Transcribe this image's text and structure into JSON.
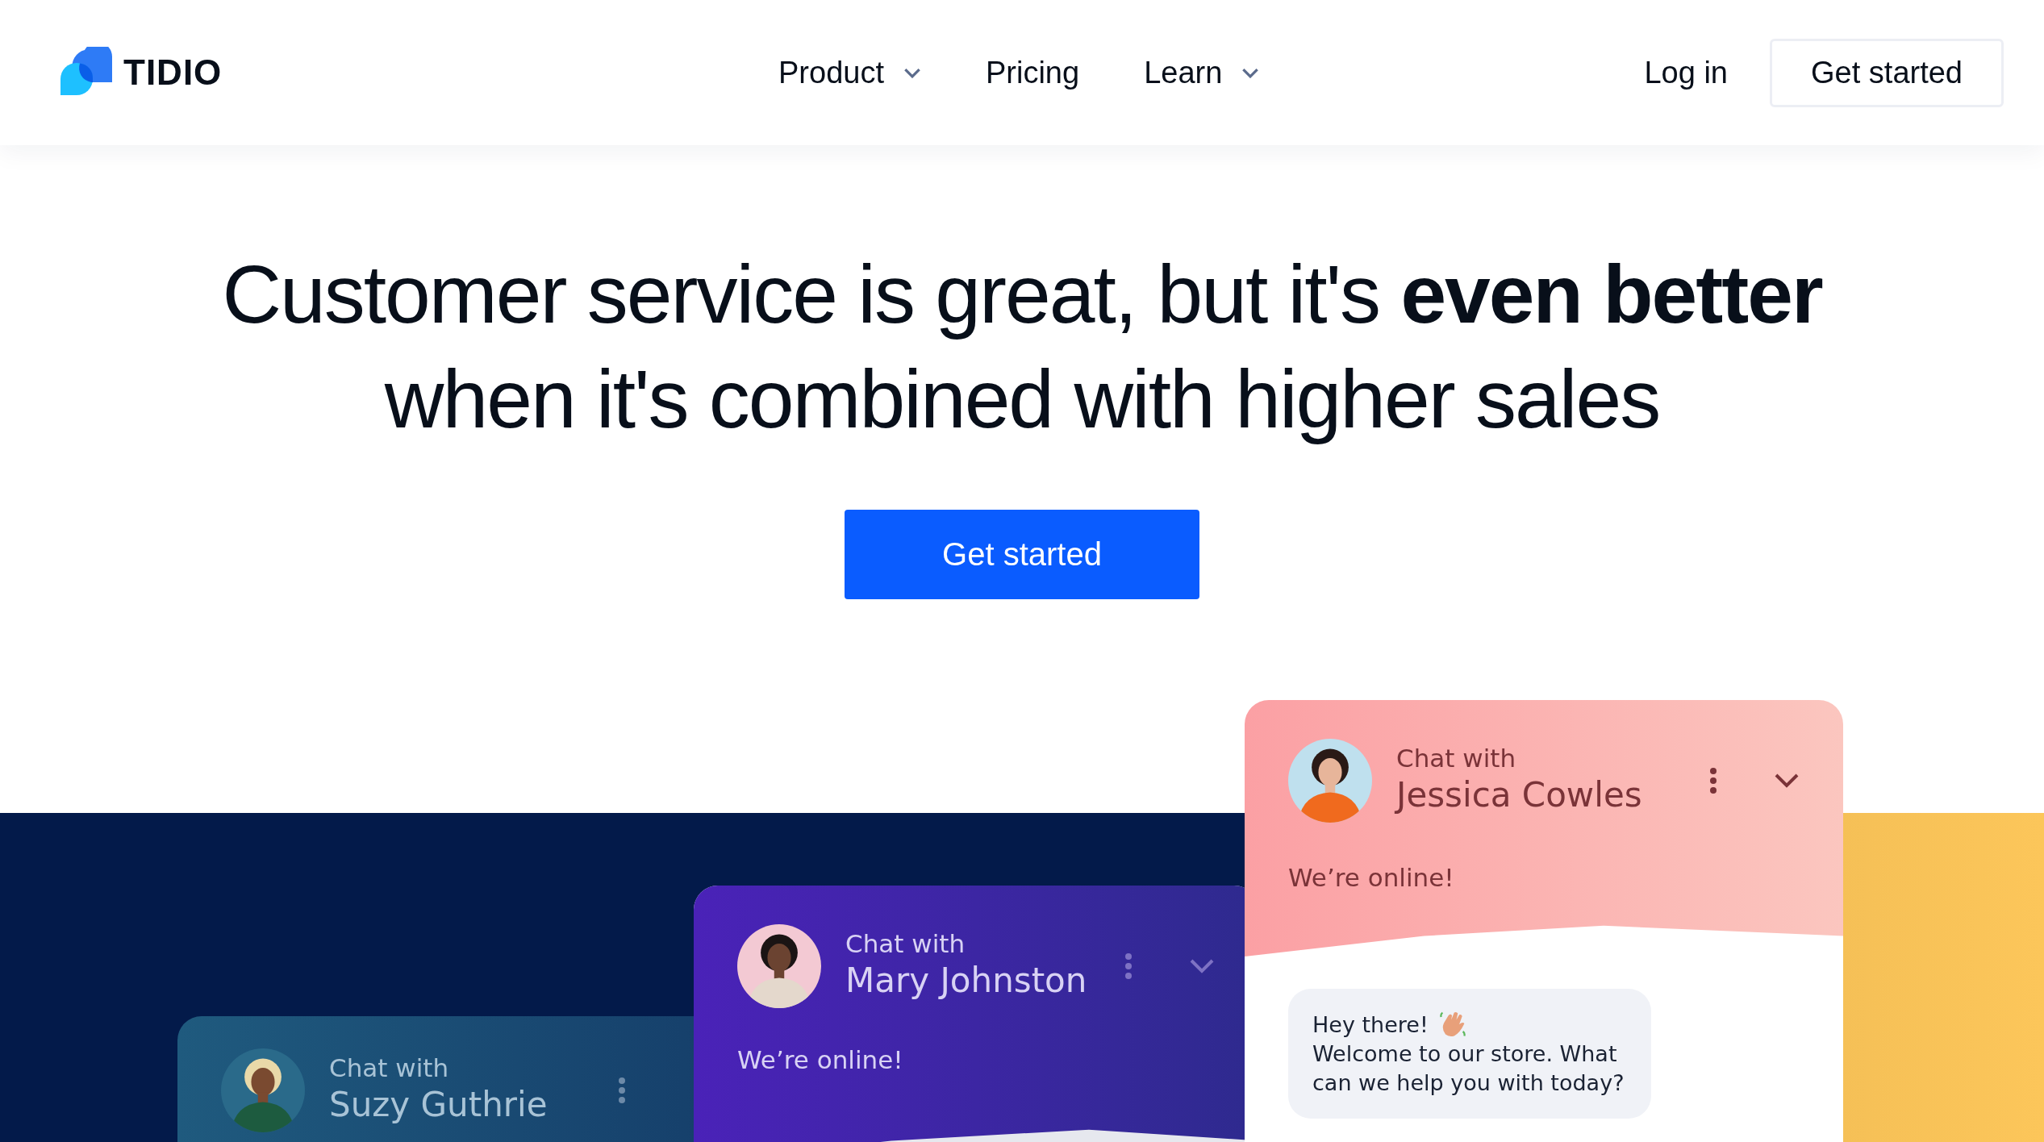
{
  "header": {
    "logo": "TIDIO",
    "nav": [
      {
        "label": "Product",
        "dropdown": true
      },
      {
        "label": "Pricing",
        "dropdown": false
      },
      {
        "label": "Learn",
        "dropdown": true
      }
    ],
    "login": "Log in",
    "cta": "Get started"
  },
  "hero": {
    "headline": "Customer service is great, but it's **even better** when it's combined with higher sales",
    "cta": "Get started"
  },
  "chats": [
    {
      "kind": "teal",
      "chat_with": "Chat with",
      "name": "Suzy Guthrie"
    },
    {
      "kind": "purple",
      "chat_with": "Chat with",
      "name": "Mary Johnston",
      "status": "We’re online!"
    },
    {
      "kind": "pink",
      "chat_with": "Chat with",
      "name": "Jessica Cowles",
      "status": "We’re online!",
      "message": [
        "Hey there!",
        "Welcome to our store. What can we help you with today?"
      ]
    }
  ]
}
